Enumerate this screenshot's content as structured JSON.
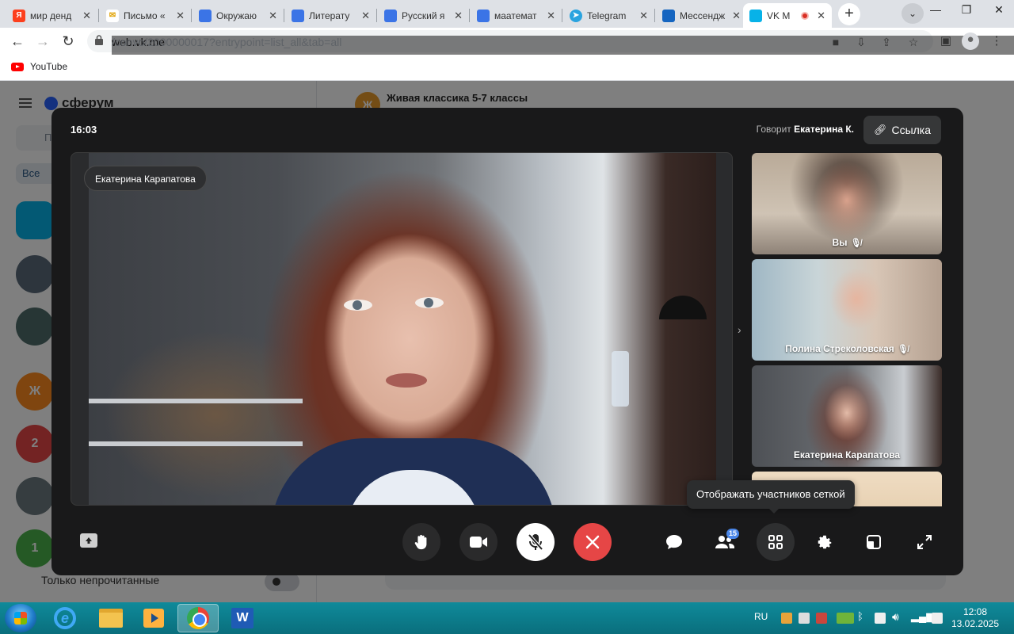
{
  "browser": {
    "tabs": [
      {
        "label": "мир денд",
        "fav": "Я",
        "fav_color": "#fc3f1d"
      },
      {
        "label": "Письмо «",
        "fav": "✉",
        "fav_color": "#f2b61c"
      },
      {
        "label": "Окружаю",
        "fav": "",
        "fav_color": "#3b74e6"
      },
      {
        "label": "Литерату",
        "fav": "",
        "fav_color": "#3b74e6"
      },
      {
        "label": "Русский я",
        "fav": "",
        "fav_color": "#3b74e6"
      },
      {
        "label": "маатемат",
        "fav": "",
        "fav_color": "#3b74e6"
      },
      {
        "label": "Telegram",
        "fav": "➤",
        "fav_color": "#2aa3df"
      },
      {
        "label": "Мессендж",
        "fav": "",
        "fav_color": "#1565c0"
      },
      {
        "label": "VK M",
        "fav": "",
        "fav_color": "#07b2e8"
      }
    ],
    "new_tab": "+",
    "window_controls": {
      "minimize": "—",
      "maximize": "❐",
      "close": "✕"
    },
    "url_host": "web.vk.me",
    "url_path": "/convo/2000000017?entrypoint=list_all&tab=all",
    "bookmark": "YouTube"
  },
  "vk_page": {
    "logo": "сферум",
    "search_placeholder": "П",
    "filter_chip": "Все",
    "avatars": [
      "",
      "",
      "Ж",
      "2",
      "",
      "1"
    ],
    "unread_only": "Только непрочитанные",
    "chat_title": "Живая классика 5-7 классы",
    "chat_avatar": "Ж"
  },
  "call": {
    "timer": "16:03",
    "speaking_prefix": "Говорит",
    "speaking_name": "Екатерина К.",
    "link_button": "Ссылка",
    "main_name": "Екатерина Карапатова",
    "participants": [
      {
        "name": "Вы",
        "muted": true
      },
      {
        "name": "Полина Стреколовская",
        "muted": true
      },
      {
        "name": "Екатерина Карапатова",
        "muted": false
      }
    ],
    "tooltip": "Отображать участников сеткой",
    "participant_count": "15"
  },
  "taskbar": {
    "language": "RU",
    "time": "12:08",
    "date": "13.02.2025"
  }
}
